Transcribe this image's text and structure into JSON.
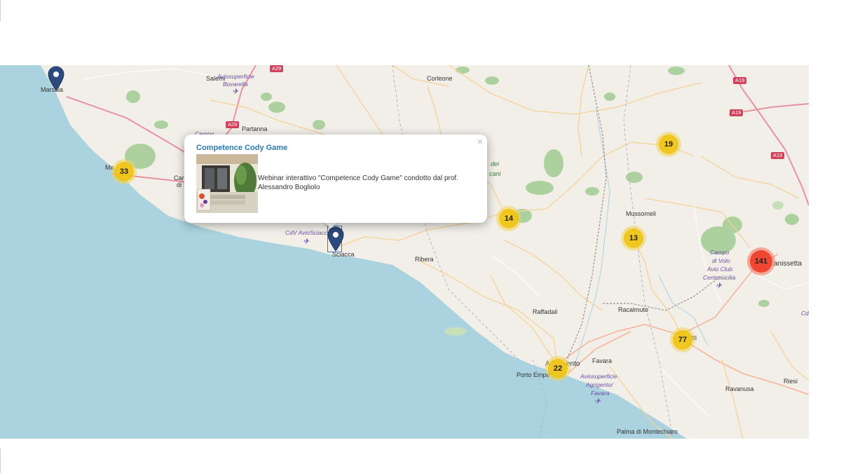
{
  "map": {
    "places": [
      {
        "id": "marsala",
        "label": "Marsala"
      },
      {
        "id": "salemi",
        "label": "Salemi"
      },
      {
        "id": "corleone",
        "label": "Corleone"
      },
      {
        "id": "partanna",
        "label": "Partanna"
      },
      {
        "id": "mazara",
        "label": "Ma"
      },
      {
        "id": "campobello",
        "label": "Can"
      },
      {
        "id": "di",
        "label": "di"
      },
      {
        "id": "sciacca",
        "label": "Sciacca"
      },
      {
        "id": "ribera",
        "label": "Ribera"
      },
      {
        "id": "mussomeli",
        "label": "Mussomeli"
      },
      {
        "id": "caltanissetta",
        "label": "anissetta"
      },
      {
        "id": "raffadali",
        "label": "Raffadali"
      },
      {
        "id": "racalmuto",
        "label": "Racalmuto"
      },
      {
        "id": "favara",
        "label": "Favara"
      },
      {
        "id": "agrigento_a",
        "label": "A"
      },
      {
        "id": "agrigento_b",
        "label": "ento"
      },
      {
        "id": "porto_empedocle",
        "label": "Porto Empe"
      },
      {
        "id": "canicatti",
        "label": "tti"
      },
      {
        "id": "ravanusa",
        "label": "Ravanusa"
      },
      {
        "id": "riesi",
        "label": "Riesi"
      },
      {
        "id": "palma",
        "label": "Palma di Montechiaro"
      }
    ],
    "airfields": [
      {
        "id": "bovarella",
        "line1": "Aviosuperficie",
        "line2": "Bovarella"
      },
      {
        "id": "avio_sciacca",
        "line1": "CdV AvioSciacca",
        "line2": ""
      },
      {
        "id": "centrosicilia",
        "line1": "Campo",
        "line2": "di Volo",
        "line3": "Avio Club",
        "line4": "Centrosicilia"
      },
      {
        "id": "agrigento_favara",
        "line1": "Aviosuperficie",
        "line2": "Agrigento/",
        "line3": "Favara"
      }
    ],
    "misc_labels": {
      "dei": "dei",
      "cani": "cani",
      "campo_left": "Campo",
      "cd": "Cd"
    },
    "road_shields": [
      "A29",
      "A29",
      "A19",
      "A19",
      "A19"
    ],
    "clusters": [
      {
        "id": "cluster-33",
        "count": "33",
        "color": "yellow"
      },
      {
        "id": "cluster-19",
        "count": "19",
        "color": "yellow"
      },
      {
        "id": "cluster-14",
        "count": "14",
        "color": "yellow"
      },
      {
        "id": "cluster-13",
        "count": "13",
        "color": "yellow"
      },
      {
        "id": "cluster-141",
        "count": "141",
        "color": "red"
      },
      {
        "id": "cluster-77",
        "count": "77",
        "color": "yellow"
      },
      {
        "id": "cluster-22",
        "count": "22",
        "color": "yellow"
      }
    ]
  },
  "popup": {
    "title": "Competence Cody Game",
    "description": "Webinar interattivo \"Competence Cody Game\" condotto dal prof. Alessandro Bogliolo",
    "close_label": "×"
  },
  "colors": {
    "sea": "#aad3df",
    "land": "#f2efe9",
    "cluster_yellow": "#f0c20c",
    "cluster_red": "#f03c28",
    "marker": "#2c4a7e",
    "popup_title": "#2a7ab0"
  }
}
